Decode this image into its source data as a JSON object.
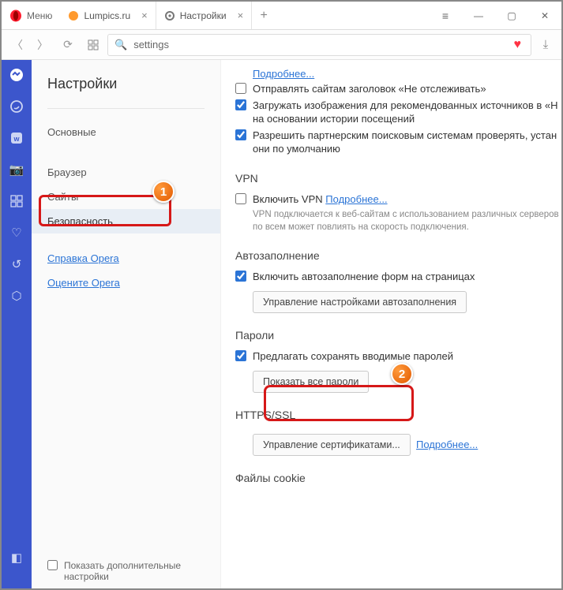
{
  "titlebar": {
    "menu_label": "Меню",
    "tabs": [
      {
        "label": "Lumpics.ru"
      },
      {
        "label": "Настройки"
      }
    ],
    "win_min": "—",
    "win_max": "▢",
    "win_close": "✕"
  },
  "addressbar": {
    "url": "settings"
  },
  "sidebar": {
    "title": "Настройки",
    "items": {
      "basic": "Основные",
      "browser": "Браузер",
      "sites": "Сайты",
      "security": "Безопасность",
      "help": "Справка Opera",
      "rate": "Оцените Opera"
    },
    "show_advanced": "Показать дополнительные настройки"
  },
  "content": {
    "more_link": "Подробнее...",
    "dnt": "Отправлять сайтам заголовок «Не отслеживать»",
    "load_images": "Загружать изображения для рекомендованных источников в «Н на основании истории посещений",
    "allow_partners": "Разрешить партнерским поисковым системам проверять, устан они по умолчанию",
    "vpn": {
      "title": "VPN",
      "enable": "Включить VPN",
      "more": "Подробнее...",
      "note": "VPN подключается к веб-сайтам с использованием различных серверов по всем может повлиять на скорость подключения."
    },
    "autofill": {
      "title": "Автозаполнение",
      "enable": "Включить автозаполнение форм на страницах",
      "manage": "Управление настройками автозаполнения"
    },
    "passwords": {
      "title": "Пароли",
      "offer": "Предлагать сохранять вводимые паролей",
      "showall": "Показать все пароли"
    },
    "https": {
      "title": "HTTPS/SSL",
      "manage": "Управление сертификатами...",
      "more": "Подробнее..."
    },
    "cookies": {
      "title": "Файлы cookie"
    }
  },
  "badges": {
    "one": "1",
    "two": "2"
  }
}
